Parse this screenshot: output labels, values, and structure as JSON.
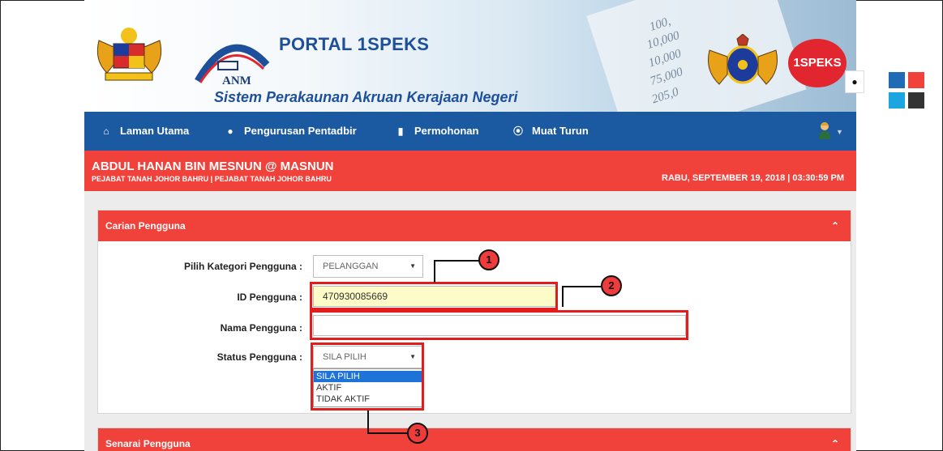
{
  "header": {
    "portal_title": "PORTAL 1SPEKS",
    "anm_label": "ANM",
    "subtitle": "Sistem Perakaunan Akruan Kerajaan Negeri",
    "brand_logo_text": "1SPEKS",
    "banner_figures": [
      "100,",
      "10,000",
      "10,000",
      "75,000",
      "205,0"
    ]
  },
  "nav": {
    "items": [
      {
        "label": "Laman Utama",
        "icon": "home-icon"
      },
      {
        "label": "Pengurusan Pentadbir",
        "icon": "user-icon"
      },
      {
        "label": "Permohonan",
        "icon": "book-icon"
      },
      {
        "label": "Muat Turun",
        "icon": "download-icon"
      }
    ]
  },
  "user": {
    "name": "ABDUL HANAN BIN MESNUN @ MASNUN",
    "office": "PEJABAT TANAH JOHOR BAHRU | PEJABAT TANAH JOHOR BAHRU",
    "datetime": "RABU, SEPTEMBER 19, 2018 | 03:30:59 PM"
  },
  "search_panel": {
    "title": "Carian Pengguna",
    "category_label": "Pilih Kategori Pengguna :",
    "category_value": "PELANGGAN",
    "id_label": "ID Pengguna :",
    "id_value": "470930085669",
    "name_label": "Nama Pengguna :",
    "name_value": "",
    "status_label": "Status Pengguna :",
    "status_value": "SILA PILIH",
    "status_options": [
      "SILA PILIH",
      "AKTIF",
      "TIDAK AKTIF"
    ]
  },
  "list_panel": {
    "title": "Senarai Pengguna"
  },
  "callouts": [
    "1",
    "2",
    "3"
  ],
  "theme_colors": [
    "#1f6bb5",
    "#f0423a",
    "#1ca5e0",
    "#333333"
  ],
  "colors": {
    "accent_red": "#f0423a",
    "nav_blue": "#1b59a0",
    "annotation_red": "#e11d1d"
  }
}
